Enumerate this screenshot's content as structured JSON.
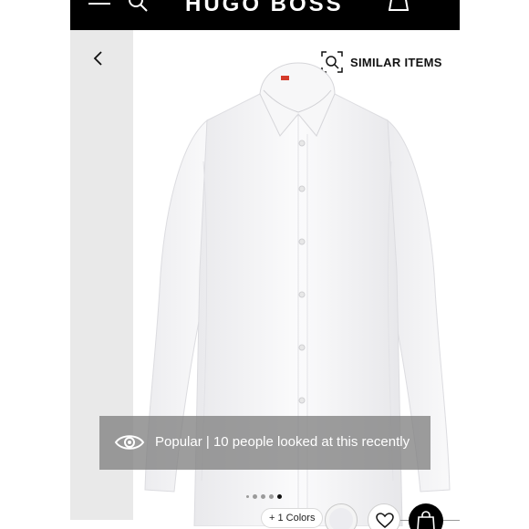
{
  "header": {
    "logo": "HUGO BOSS",
    "menu_icon": "menu-icon",
    "search_icon": "search-icon",
    "bag_icon": "shopping-bag-icon"
  },
  "gallery": {
    "back_icon": "chevron-left-icon",
    "similar_items_label": "SIMILAR ITEMS",
    "similar_icon": "visual-search-icon",
    "image_subject": "white dress shirt",
    "dots_count": 5,
    "active_dot": 5
  },
  "popular": {
    "icon": "eye-icon",
    "title": "Popular",
    "separator": " | ",
    "message": "10 people looked at this recently"
  },
  "bottom_bar": {
    "colors_label": "+ 1 Colors",
    "wishlist_icon": "heart-icon",
    "add_to_bag_icon": "shopping-bag-icon"
  },
  "colors": {
    "header_bg": "#000000",
    "gallery_strip": "#e9e9e9",
    "banner_bg": "#828282"
  }
}
